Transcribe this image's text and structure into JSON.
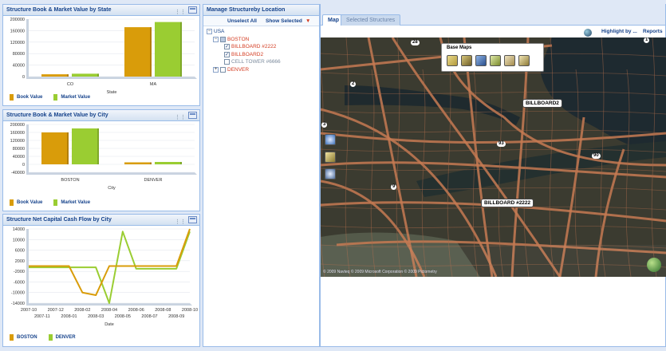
{
  "colors": {
    "boston": "#d99c0a",
    "denver": "#9acd32",
    "header_text": "#15428b",
    "link_red": "#d33b20"
  },
  "panels": {
    "state_chart": {
      "title": "Structure Book & Market Value by State"
    },
    "city_chart": {
      "title": "Structure Book & Market Value by City"
    },
    "cashflow_chart": {
      "title": "Structure Net Capital Cash Flow by City"
    },
    "manage": {
      "title": "Manage Structureby Location"
    }
  },
  "chart_data": [
    {
      "type": "bar",
      "categories": [
        "CO",
        "MA"
      ],
      "series": [
        {
          "name": "Book Value",
          "values": [
            8000,
            172000
          ]
        },
        {
          "name": "Market Value",
          "values": [
            10000,
            190000
          ]
        }
      ],
      "xlabel": "State",
      "ylim": [
        0,
        200000
      ],
      "yticks": [
        200000,
        160000,
        120000,
        80000,
        40000,
        0
      ],
      "legend": "bottom-left"
    },
    {
      "type": "bar",
      "categories": [
        "BOSTON",
        "DENVER"
      ],
      "series": [
        {
          "name": "Book Value",
          "values": [
            160000,
            10000
          ]
        },
        {
          "name": "Market Value",
          "values": [
            180000,
            12000
          ]
        }
      ],
      "xlabel": "City",
      "ylim": [
        -40000,
        200000
      ],
      "yticks": [
        200000,
        160000,
        120000,
        80000,
        40000,
        0,
        -40000
      ],
      "legend": "bottom-left"
    },
    {
      "type": "line",
      "x": [
        "2007-10",
        "2007-11",
        "2007-12",
        "2008-01",
        "2008-02",
        "2008-03",
        "2008-04",
        "2008-05",
        "2008-06",
        "2008-07",
        "2008-08",
        "2008-09",
        "2008-10"
      ],
      "series": [
        {
          "name": "BOSTON",
          "values": [
            0,
            0,
            0,
            0,
            -10000,
            -11000,
            0,
            0,
            0,
            0,
            0,
            0,
            14000
          ]
        },
        {
          "name": "DENVER",
          "values": [
            -500,
            -500,
            -500,
            -500,
            -500,
            -500,
            -14000,
            13000,
            -1000,
            -1000,
            -1000,
            -1000,
            13000
          ]
        }
      ],
      "xlabel": "Date",
      "ylim": [
        -14000,
        14000
      ],
      "yticks": [
        14000,
        10000,
        6000,
        2000,
        -2000,
        -6000,
        -10000,
        -14000
      ],
      "xticks_top": [
        "2007-10",
        "2007-12",
        "2008-02",
        "2008-04",
        "2008-06",
        "2008-08",
        "2008-10"
      ],
      "xticks_bottom": [
        "2007-11",
        "2008-01",
        "2008-03",
        "2008-05",
        "2008-07",
        "2008-09"
      ],
      "legend": "bottom-left"
    }
  ],
  "tree": {
    "unselect_all": "Unselect All",
    "show_selected": "Show Selected",
    "nodes": {
      "usa": "USA",
      "boston": "BOSTON",
      "bb2222": "BILLBOARD #2222",
      "bb2": "BILLBOARD2",
      "tower": "CELL TOWER #6666",
      "denver": "DENVER"
    }
  },
  "map": {
    "tabs": [
      "Map",
      "Selected Structures"
    ],
    "highlight": "Highlight by ...",
    "reports": "Reports",
    "base_maps_title": "Base Maps",
    "callouts": [
      "BILLBOARD2",
      "BILLBOARD #2222"
    ],
    "pins": [
      "28",
      "2",
      "3",
      "93",
      "9",
      "90",
      "1"
    ],
    "copyright": "© 2009 Navteq  © 2009 Microsoft Corporation  © 2009 Pictometry"
  }
}
